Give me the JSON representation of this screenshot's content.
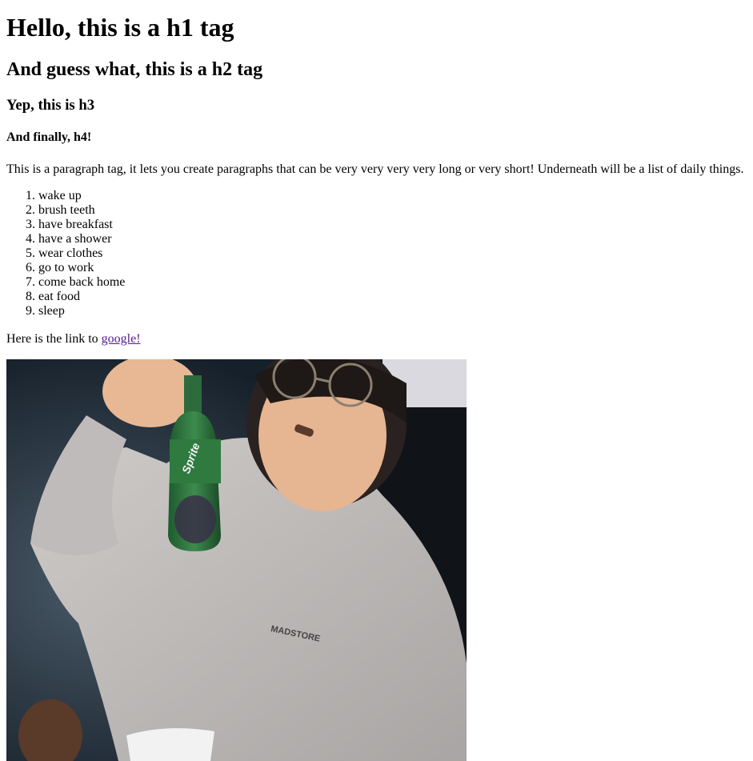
{
  "headings": {
    "h1": "Hello, this is a h1 tag",
    "h2": "And guess what, this is a h2 tag",
    "h3": "Yep, this is h3",
    "h4": "And finally, h4!"
  },
  "paragraph": "This is a paragraph tag, it lets you create paragraphs that can be very very very very long or very short! Underneath will be a list of daily things.",
  "list": {
    "items": [
      {
        "number": "1.",
        "label": "wake up"
      },
      {
        "number": "2.",
        "label": "brush teeth"
      },
      {
        "number": "3.",
        "label": "have breakfast"
      },
      {
        "number": "4.",
        "label": "have a shower"
      },
      {
        "number": "5.",
        "label": "wear clothes"
      },
      {
        "number": "6.",
        "label": "go to work"
      },
      {
        "number": "7.",
        "label": "come back home"
      },
      {
        "number": "8.",
        "label": "eat food"
      },
      {
        "number": "9.",
        "label": "sleep"
      }
    ]
  },
  "link_line": {
    "prefix": "Here is the link to ",
    "link_text": "google!",
    "link_color": "#551a8b"
  },
  "photo": {
    "hoodie_print": "MADSTORE",
    "bottle_label": "Sprite"
  }
}
